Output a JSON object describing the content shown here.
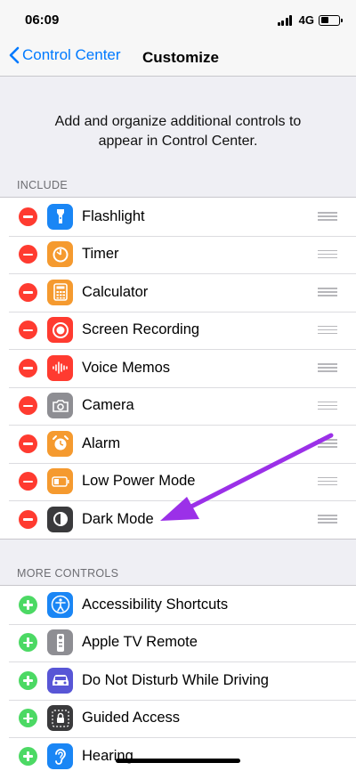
{
  "status_bar": {
    "time": "06:09",
    "network": "4G"
  },
  "nav": {
    "back_label": "Control Center",
    "title": "Customize"
  },
  "intro_text": "Add and organize additional controls to appear in Control Center.",
  "include": {
    "header": "INCLUDE",
    "items": [
      {
        "label": "Flashlight",
        "icon": "flashlight-icon",
        "color": "#1a86f5"
      },
      {
        "label": "Timer",
        "icon": "timer-icon",
        "color": "#f59a2f"
      },
      {
        "label": "Calculator",
        "icon": "calculator-icon",
        "color": "#f59a2f"
      },
      {
        "label": "Screen Recording",
        "icon": "record-icon",
        "color": "#ff3b30"
      },
      {
        "label": "Voice Memos",
        "icon": "waveform-icon",
        "color": "#ff3b30"
      },
      {
        "label": "Camera",
        "icon": "camera-icon",
        "color": "#8e8e93"
      },
      {
        "label": "Alarm",
        "icon": "alarm-icon",
        "color": "#f59a2f"
      },
      {
        "label": "Low Power Mode",
        "icon": "battery-icon",
        "color": "#f59a2f"
      },
      {
        "label": "Dark Mode",
        "icon": "dark-mode-icon",
        "color": "#3a3a3c"
      }
    ]
  },
  "more_controls": {
    "header": "MORE CONTROLS",
    "items": [
      {
        "label": "Accessibility Shortcuts",
        "icon": "accessibility-icon",
        "color": "#1a86f5"
      },
      {
        "label": "Apple TV Remote",
        "icon": "remote-icon",
        "color": "#8e8e93"
      },
      {
        "label": "Do Not Disturb While Driving",
        "icon": "car-icon",
        "color": "#5856d6"
      },
      {
        "label": "Guided Access",
        "icon": "lock-icon",
        "color": "#3a3a3c"
      },
      {
        "label": "Hearing",
        "icon": "ear-icon",
        "color": "#1a86f5"
      }
    ]
  },
  "annotation": {
    "arrow_color": "#9b30e8"
  }
}
